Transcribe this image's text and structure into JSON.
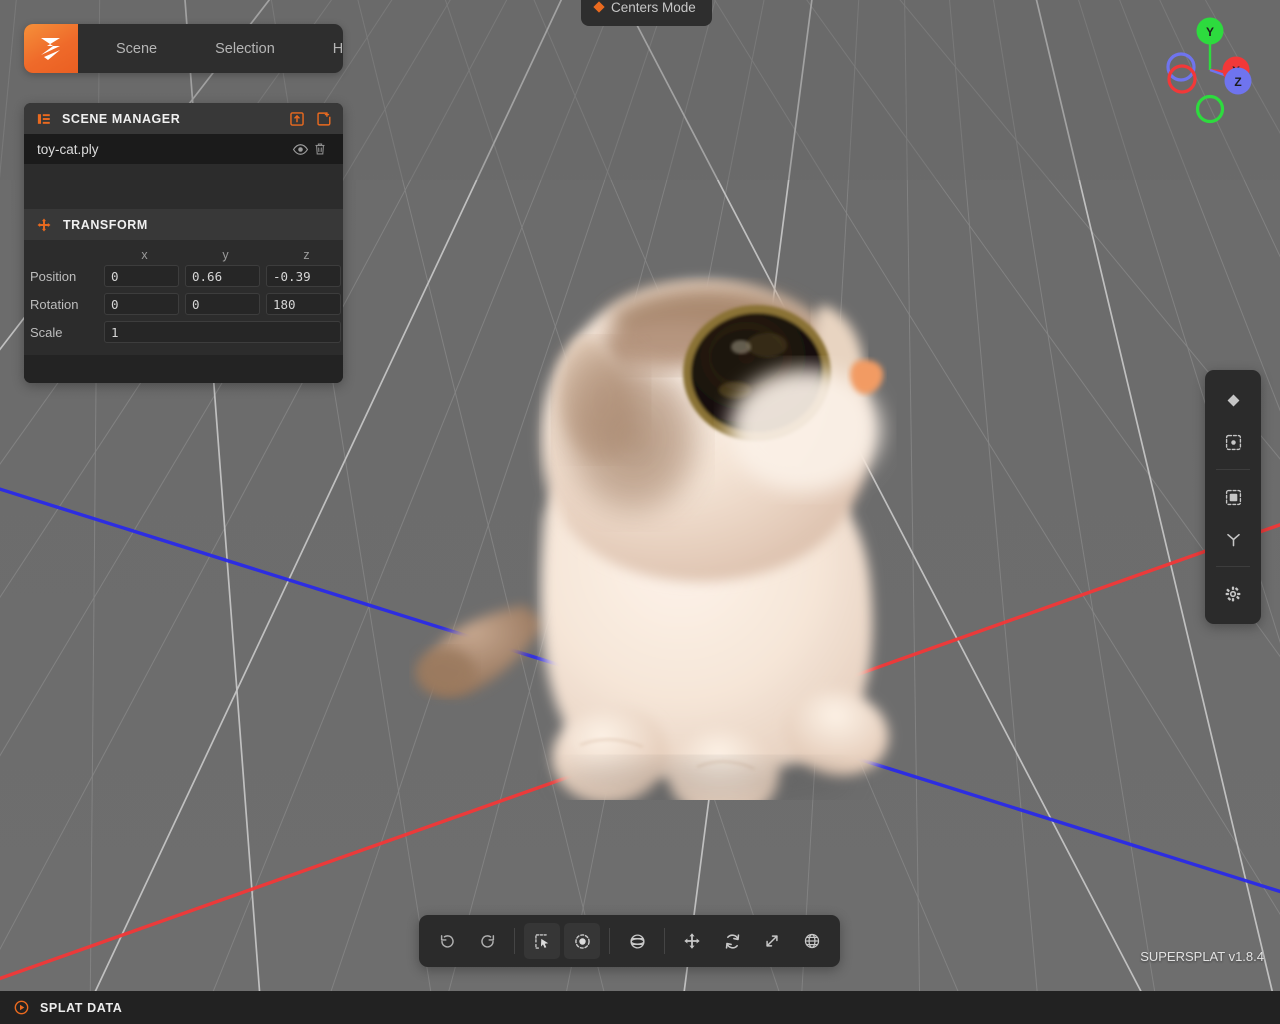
{
  "app": {
    "name": "SuperSplat",
    "version_label": "SUPERSPLAT v1.8.4",
    "logo_icon": "supersplat-logo-icon",
    "accent_color": "#ea6a1f",
    "panel_bg": "#2c2c2c",
    "header_bg": "#383838",
    "viewport_bg": "#6b6b6b"
  },
  "menu_bar": {
    "items": [
      {
        "label": "Scene",
        "icon": "menu-scene"
      },
      {
        "label": "Selection",
        "icon": "menu-selection"
      },
      {
        "label": "Help",
        "icon": "menu-help"
      }
    ],
    "panel_toggle_icon": "panel-layout-icon"
  },
  "centers_mode": {
    "label": "Centers Mode",
    "indicator_icon": "diamond-icon",
    "indicator_color": "#ea6a1f"
  },
  "scene_manager": {
    "title": "SCENE MANAGER",
    "header_icon": "list-icon",
    "actions": [
      {
        "name": "import-scene",
        "icon": "import-box-arrow-up-icon"
      },
      {
        "name": "new-scene",
        "icon": "new-box-plus-icon"
      }
    ],
    "items": [
      {
        "name": "toy-cat.ply",
        "selected": true,
        "visibility_icon": "eye-icon",
        "delete_icon": "trash-icon"
      }
    ]
  },
  "transform": {
    "title": "TRANSFORM",
    "header_icon": "move-arrows-icon",
    "axis_headers": [
      "x",
      "y",
      "z"
    ],
    "rows": [
      {
        "label": "Position",
        "values": [
          "0",
          "0.66",
          "-0.39"
        ]
      },
      {
        "label": "Rotation",
        "values": [
          "0",
          "0",
          "180"
        ]
      }
    ],
    "scale": {
      "label": "Scale",
      "value": "1"
    }
  },
  "right_rail": {
    "buttons": [
      {
        "name": "splat-render-mode",
        "icon": "diamond-icon"
      },
      {
        "name": "camera-focus",
        "icon": "focus-frame-dot-icon"
      },
      {
        "name": "bounding-box",
        "icon": "bounding-box-icon"
      },
      {
        "name": "axis-tripod",
        "icon": "tripod-axis-icon"
      },
      {
        "name": "settings",
        "icon": "gear-icon"
      }
    ],
    "separator_after": [
      1,
      3
    ]
  },
  "bottom_toolbar": {
    "buttons": [
      {
        "name": "undo",
        "icon": "undo-arrow-icon",
        "active": false
      },
      {
        "name": "redo",
        "icon": "redo-arrow-icon",
        "active": false
      },
      {
        "name": "rect-select",
        "icon": "marquee-cursor-icon",
        "active": true
      },
      {
        "name": "brush-select",
        "icon": "brush-circle-icon",
        "active": true
      },
      {
        "name": "sphere-select",
        "icon": "sphere-icon",
        "active": false
      },
      {
        "name": "translate-tool",
        "icon": "move-arrows-icon",
        "active": false
      },
      {
        "name": "rotate-tool",
        "icon": "rotate-arrows-icon",
        "active": false
      },
      {
        "name": "scale-tool",
        "icon": "scale-diagonal-arrow-icon",
        "active": false
      },
      {
        "name": "coordinate-space",
        "icon": "globe-icon",
        "active": false
      }
    ]
  },
  "status_bar": {
    "title": "SPLAT DATA",
    "icon": "circle-play-icon",
    "icon_color": "#ea6a1f"
  },
  "axis_gizmo": {
    "axes": [
      {
        "label": "Y",
        "color": "#22dd33",
        "filled": true
      },
      {
        "label": "X",
        "color": "#f23838",
        "filled": true
      },
      {
        "label": "Z",
        "color": "#5a5ef0",
        "filled": true
      }
    ],
    "negative_axes": [
      {
        "label": "-Y",
        "color": "#22dd33"
      },
      {
        "label": "-X",
        "color": "#f23838"
      },
      {
        "label": "-Z",
        "color": "#5a5ef0"
      }
    ]
  },
  "viewport": {
    "grid_color": "#8d8d8d",
    "grid_major_color": "#c9c9c9",
    "x_axis_color": "#f23838",
    "z_axis_color": "#2a2ae8",
    "model_name": "toy-cat.ply",
    "model_description": "plush cat toy gaussian splat"
  }
}
